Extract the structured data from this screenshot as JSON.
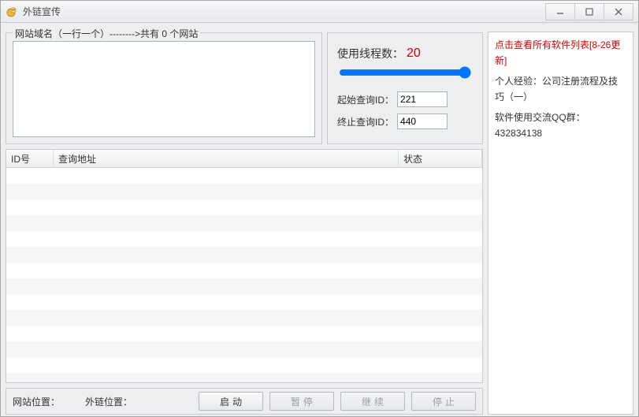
{
  "window": {
    "title": "外链宣传"
  },
  "domains": {
    "legend_prefix": "网站域名（一行一个）-------->共有 ",
    "count": "0",
    "legend_suffix": " 个网站",
    "textarea_value": ""
  },
  "threads": {
    "label": "使用线程数：",
    "value": "20",
    "start_id_label": "起始查询ID：",
    "start_id_value": "221",
    "end_id_label": "终止查询ID：",
    "end_id_value": "440"
  },
  "table": {
    "headers": {
      "id": "ID号",
      "url": "查询地址",
      "status": "状态"
    },
    "rows": []
  },
  "bottom": {
    "site_pos_label": "网站位置：",
    "link_pos_label": "外链位置：",
    "buttons": {
      "start": "启动",
      "pause": "暂停",
      "resume": "继续",
      "stop": "停止"
    }
  },
  "sidebar": {
    "link_text": "点击查看所有软件列表[8-26更新]",
    "line2": "个人经验：公司注册流程及技巧（一）",
    "qq_label": "软件使用交流QQ群：",
    "qq_number": "432834138"
  }
}
